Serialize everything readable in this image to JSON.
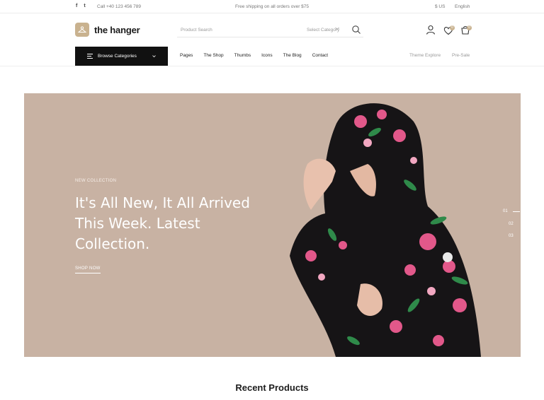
{
  "topbar": {
    "social": [
      "f",
      "t"
    ],
    "phone": "Call +40 123 456 789",
    "shipping": "Free shipping on all orders over $75",
    "currency": "$ US",
    "language": "English"
  },
  "header": {
    "logo_text": "the hanger",
    "search_placeholder": "Product Search",
    "search_category": "Select Category",
    "wishlist_count": "0",
    "cart_count": "0"
  },
  "nav": {
    "browse_label": "Browse Categories",
    "items": [
      "Pages",
      "The Shop",
      "Thumbs",
      "Icons",
      "The Blog",
      "Contact"
    ],
    "right_items": [
      "Theme Explore",
      "Pre-Sale"
    ]
  },
  "hero": {
    "eyebrow": "NEW COLLECTION",
    "title": "It's All New, It All Arrived This Week. Latest Collection.",
    "cta": "SHOP NOW",
    "pager": [
      "01",
      "02",
      "03"
    ]
  },
  "section": {
    "title": "Recent Products"
  },
  "colors": {
    "accent": "#c9b28f",
    "hero_bg": "#c8b2a3",
    "dark": "#111111"
  }
}
